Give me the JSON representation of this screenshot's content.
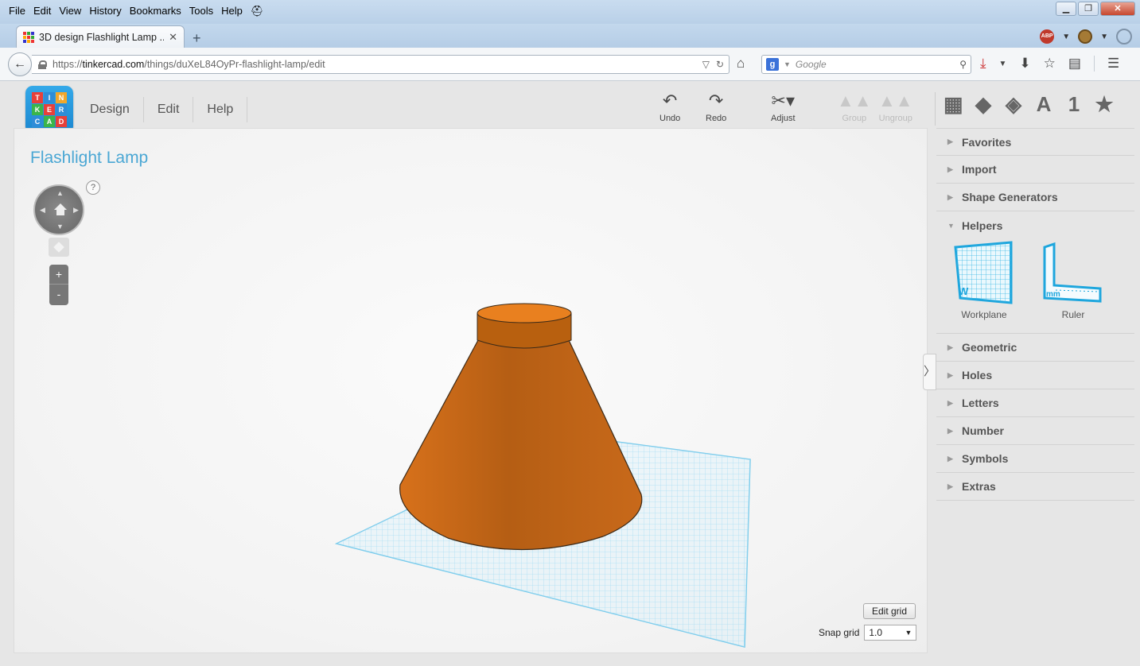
{
  "browser": {
    "menu": [
      "File",
      "Edit",
      "View",
      "History",
      "Bookmarks",
      "Tools",
      "Help"
    ],
    "tab_title": "3D design Flashlight Lamp ...",
    "url_prefix": "https://",
    "url_host": "tinkercad.com",
    "url_path": "/things/duXeL84OyPr-flashlight-lamp/edit",
    "search_placeholder": "Google",
    "abp_label": "ABP",
    "search_engine_letter": "g"
  },
  "app": {
    "logo": [
      "TIN",
      "KER",
      "CAD"
    ],
    "menu": [
      "Design",
      "Edit",
      "Help"
    ],
    "toolbar": {
      "undo": "Undo",
      "redo": "Redo",
      "adjust": "Adjust",
      "group": "Group",
      "ungroup": "Ungroup"
    },
    "view_icons": {
      "text_icon": "A",
      "number_icon": "1"
    },
    "design_title": "Flashlight Lamp",
    "help_q": "?",
    "edit_grid": "Edit grid",
    "snap_label": "Snap grid",
    "snap_value": "1.0",
    "zoom_in": "+",
    "zoom_out": "-",
    "workplane_letter": "W",
    "ruler_unit": "mm",
    "shape_color": "#e07b1f",
    "grid_color": "#8fd4ef"
  },
  "sidebar": {
    "sections_top": [
      "Favorites",
      "Import",
      "Shape Generators",
      "Helpers"
    ],
    "helpers": [
      "Workplane",
      "Ruler"
    ],
    "sections_bottom": [
      "Geometric",
      "Holes",
      "Letters",
      "Number",
      "Symbols",
      "Extras"
    ]
  }
}
